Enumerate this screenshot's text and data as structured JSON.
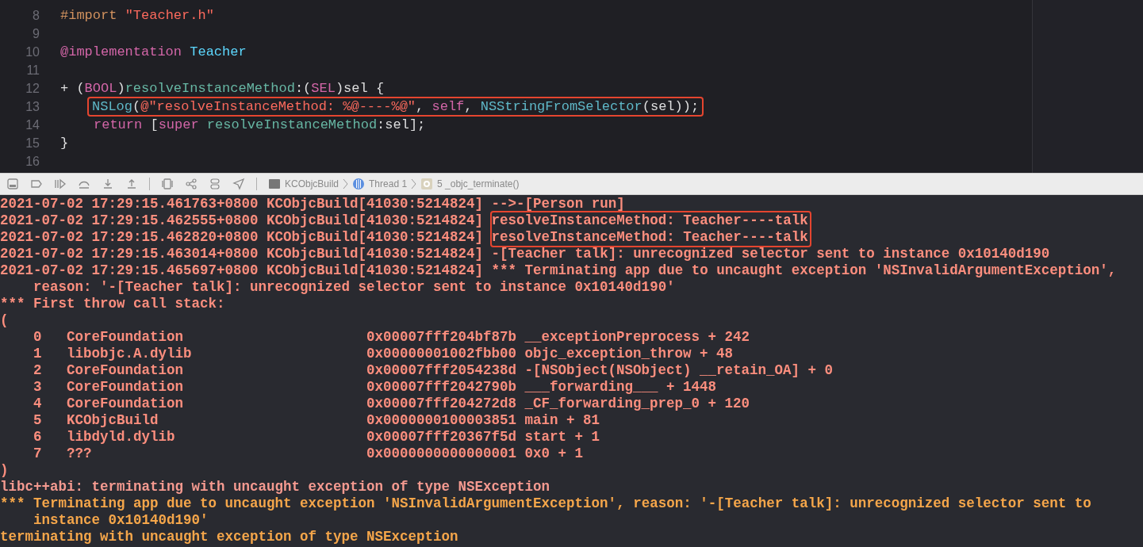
{
  "editor": {
    "lines": [
      {
        "number": "8",
        "highlighted": false,
        "tokens": [
          {
            "text": "#import ",
            "kind": "preprocessor"
          },
          {
            "text": "\"Teacher.h\"",
            "kind": "string"
          }
        ]
      },
      {
        "number": "9"
      },
      {
        "number": "10",
        "highlighted": false,
        "tokens": [
          {
            "text": "@implementation ",
            "kind": "keyword"
          },
          {
            "text": "Teacher",
            "kind": "class"
          }
        ]
      },
      {
        "number": "11"
      },
      {
        "number": "12",
        "highlighted": false,
        "tokens": [
          {
            "text": "+ (",
            "kind": "plain"
          },
          {
            "text": "BOOL",
            "kind": "keyword"
          },
          {
            "text": ")",
            "kind": "plain"
          },
          {
            "text": "resolveInstanceMethod",
            "kind": "method"
          },
          {
            "text": ":(",
            "kind": "plain"
          },
          {
            "text": "SEL",
            "kind": "keyword"
          },
          {
            "text": ")sel {",
            "kind": "plain"
          }
        ],
        "children": [
          {
            "number": "13",
            "highlighted": true,
            "tokens": [
              {
                "text": "NSLog",
                "kind": "call"
              },
              {
                "text": "(",
                "kind": "plain"
              },
              {
                "text": "@\"resolveInstanceMethod: %@----%@\"",
                "kind": "string"
              },
              {
                "text": ", ",
                "kind": "plain"
              },
              {
                "text": "self",
                "kind": "keyword"
              },
              {
                "text": ", ",
                "kind": "plain"
              },
              {
                "text": "NSStringFromSelector",
                "kind": "call"
              },
              {
                "text": "(sel));",
                "kind": "plain"
              }
            ]
          },
          {
            "number": "14",
            "highlighted": false,
            "tokens": [
              {
                "text": "return",
                "kind": "keyword"
              },
              {
                "text": " [",
                "kind": "plain"
              },
              {
                "text": "super ",
                "kind": "keyword"
              },
              {
                "text": "resolveInstanceMethod",
                "kind": "method"
              },
              {
                "text": ":sel];",
                "kind": "plain"
              }
            ]
          }
        ]
      },
      {
        "number": "15",
        "highlighted": false,
        "tokens": [
          {
            "text": "}",
            "kind": "plain"
          }
        ]
      },
      {
        "number": "16"
      }
    ]
  },
  "debug_bar": {
    "breadcrumbs": [
      {
        "label": "KCObjcBuild",
        "kind": "target"
      },
      {
        "label": "Thread 1",
        "kind": "thread"
      },
      {
        "label": "5 _objc_terminate()",
        "kind": "frame"
      }
    ]
  },
  "console": [
    {
      "kind": "log",
      "prefix": "2021-07-02 17:29:15.461763+0800 KCObjcBuild[41030:5214824]",
      "message": "-->-[Person run]",
      "highlighted": false
    },
    {
      "kind": "log",
      "prefix": "2021-07-02 17:29:15.462555+0800 KCObjcBuild[41030:5214824]",
      "message": "resolveInstanceMethod: Teacher----talk",
      "highlighted": true
    },
    {
      "kind": "log",
      "prefix": "2021-07-02 17:29:15.462820+0800 KCObjcBuild[41030:5214824]",
      "message": "resolveInstanceMethod: Teacher----talk",
      "highlighted": true
    },
    {
      "kind": "log",
      "prefix": "2021-07-02 17:29:15.463014+0800 KCObjcBuild[41030:5214824]",
      "message": "-[Teacher talk]: unrecognized selector sent to instance 0x10140d190",
      "highlighted": false
    },
    {
      "kind": "log",
      "prefix": "2021-07-02 17:29:15.465697+0800 KCObjcBuild[41030:5214824]",
      "message": "*** Terminating app due to uncaught exception 'NSInvalidArgumentException',",
      "continuation": "reason: '-[Teacher talk]: unrecognized selector sent to instance 0x10140d190'",
      "highlighted": false
    },
    {
      "kind": "text",
      "text": "*** First throw call stack:",
      "color": "#fc8e7e"
    },
    {
      "kind": "text",
      "text": "(",
      "color": "#fc8e7e"
    },
    {
      "kind": "frame",
      "index": "0",
      "library": "CoreFoundation",
      "address": "0x00007fff204bf87b",
      "symbol": "__exceptionPreprocess + 242"
    },
    {
      "kind": "frame",
      "index": "1",
      "library": "libobjc.A.dylib",
      "address": "0x00000001002fbb00",
      "symbol": "objc_exception_throw + 48"
    },
    {
      "kind": "frame",
      "index": "2",
      "library": "CoreFoundation",
      "address": "0x00007fff2054238d",
      "symbol": "-[NSObject(NSObject) __retain_OA] + 0"
    },
    {
      "kind": "frame",
      "index": "3",
      "library": "CoreFoundation",
      "address": "0x00007fff2042790b",
      "symbol": "___forwarding___ + 1448"
    },
    {
      "kind": "frame",
      "index": "4",
      "library": "CoreFoundation",
      "address": "0x00007fff204272d8",
      "symbol": "_CF_forwarding_prep_0 + 120"
    },
    {
      "kind": "frame",
      "index": "5",
      "library": "KCObjcBuild",
      "address": "0x0000000100003851",
      "symbol": "main + 81"
    },
    {
      "kind": "frame",
      "index": "6",
      "library": "libdyld.dylib",
      "address": "0x00007fff20367f5d",
      "symbol": "start + 1"
    },
    {
      "kind": "frame",
      "index": "7",
      "library": "???",
      "address": "0x0000000000000001",
      "symbol": "0x0 + 1"
    },
    {
      "kind": "text",
      "text": ")",
      "color": "#fc8e7e"
    },
    {
      "kind": "text",
      "text": "libc++abi: terminating with uncaught exception of type NSException",
      "color": "#f59a90"
    },
    {
      "kind": "text",
      "text": "*** Terminating app due to uncaught exception 'NSInvalidArgumentException', reason: '-[Teacher talk]: unrecognized selector sent to",
      "continuation": "instance 0x10140d190'",
      "color": "#f5a64a"
    },
    {
      "kind": "text",
      "text": "terminating with uncaught exception of type NSException",
      "color": "#f5a64a"
    }
  ]
}
